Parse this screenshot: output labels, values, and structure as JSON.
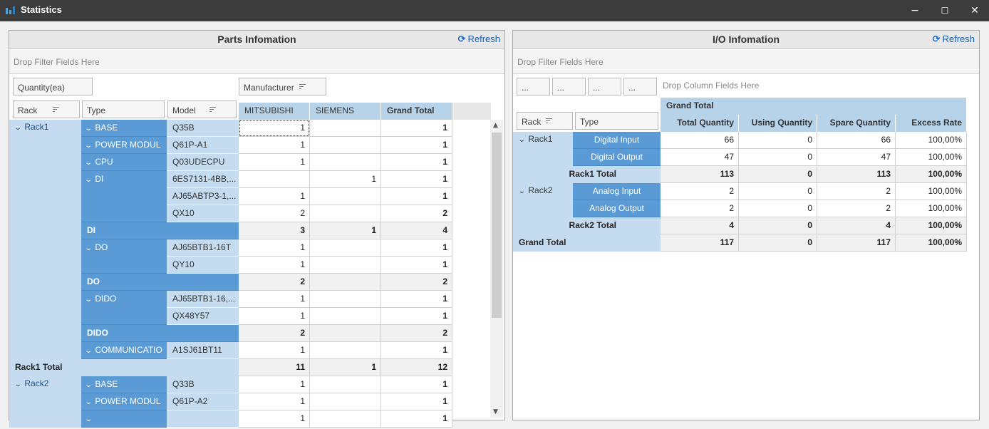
{
  "window": {
    "title": "Statistics",
    "minimize": "−",
    "maximize": "☐",
    "close": "✕"
  },
  "parts": {
    "title": "Parts Infomation",
    "refresh": "Refresh",
    "filter_zone": "Drop Filter Fields Here",
    "data_field": "Quantity(ea)",
    "column_field": "Manufacturer",
    "row_fields": [
      "Rack",
      "Type",
      "Model"
    ],
    "columns": [
      "MITSUBISHI",
      "SIEMENS",
      "Grand Total"
    ],
    "rows": [
      {
        "type": "BASE",
        "model": "Q35B",
        "m": "1",
        "s": "",
        "g": "1"
      },
      {
        "type": "POWER MODUL",
        "model": "Q61P-A1",
        "m": "1",
        "s": "",
        "g": "1"
      },
      {
        "type": "CPU",
        "model": "Q03UDECPU",
        "m": "1",
        "s": "",
        "g": "1"
      },
      {
        "type": "DI",
        "model": "6ES7131-4BB,...",
        "m": "",
        "s": "1",
        "g": "1"
      },
      {
        "type": "",
        "model": "AJ65ABTP3-1,...",
        "m": "1",
        "s": "",
        "g": "1"
      },
      {
        "type": "",
        "model": "QX10",
        "m": "2",
        "s": "",
        "g": "2"
      },
      {
        "subtotal": "DI",
        "m": "3",
        "s": "1",
        "g": "4"
      },
      {
        "type": "DO",
        "model": "AJ65BTB1-16T",
        "m": "1",
        "s": "",
        "g": "1"
      },
      {
        "type": "",
        "model": "QY10",
        "m": "1",
        "s": "",
        "g": "1"
      },
      {
        "subtotal": "DO",
        "m": "2",
        "s": "",
        "g": "2"
      },
      {
        "type": "DIDO",
        "model": "AJ65BTB1-16,...",
        "m": "1",
        "s": "",
        "g": "1"
      },
      {
        "type": "",
        "model": "QX48Y57",
        "m": "1",
        "s": "",
        "g": "1"
      },
      {
        "subtotal": "DIDO",
        "m": "2",
        "s": "",
        "g": "2"
      },
      {
        "type": "COMMUNICATIO",
        "model": "A1SJ61BT11",
        "m": "1",
        "s": "",
        "g": "1"
      },
      {
        "racktotal": "Rack1 Total",
        "m": "11",
        "s": "1",
        "g": "12"
      },
      {
        "type": "BASE",
        "model": "Q33B",
        "m": "1",
        "s": "",
        "g": "1"
      },
      {
        "type": "POWER MODUL",
        "model": "Q61P-A2",
        "m": "1",
        "s": "",
        "g": "1"
      },
      {
        "type": "",
        "model": "",
        "m": "1",
        "s": "",
        "g": "1"
      }
    ],
    "racks": [
      "Rack1",
      "Rack2"
    ]
  },
  "io": {
    "title": "I/O Infomation",
    "refresh": "Refresh",
    "filter_zone": "Drop Filter Fields Here",
    "placeholders": [
      "...",
      "...",
      "...",
      "..."
    ],
    "column_zone": "Drop Column Fields Here",
    "grand_total_header": "Grand Total",
    "row_fields": [
      "Rack",
      "Type"
    ],
    "columns": [
      "Total Quantity",
      "Using Quantity",
      "Spare Quantity",
      "Excess Rate"
    ],
    "rows": [
      {
        "type": "Digital Input",
        "vals": [
          "66",
          "0",
          "66",
          "100,00%"
        ]
      },
      {
        "type": "Digital Output",
        "vals": [
          "47",
          "0",
          "47",
          "100,00%"
        ]
      },
      {
        "total": "Rack1 Total",
        "vals": [
          "113",
          "0",
          "113",
          "100,00%"
        ]
      },
      {
        "type": "Analog Input",
        "vals": [
          "2",
          "0",
          "2",
          "100,00%"
        ]
      },
      {
        "type": "Analog Output",
        "vals": [
          "2",
          "0",
          "2",
          "100,00%"
        ]
      },
      {
        "total": "Rack2 Total",
        "vals": [
          "4",
          "0",
          "4",
          "100,00%"
        ]
      },
      {
        "grand": "Grand Total",
        "vals": [
          "117",
          "0",
          "117",
          "100,00%"
        ]
      }
    ],
    "racks": [
      "Rack1",
      "Rack2"
    ]
  }
}
